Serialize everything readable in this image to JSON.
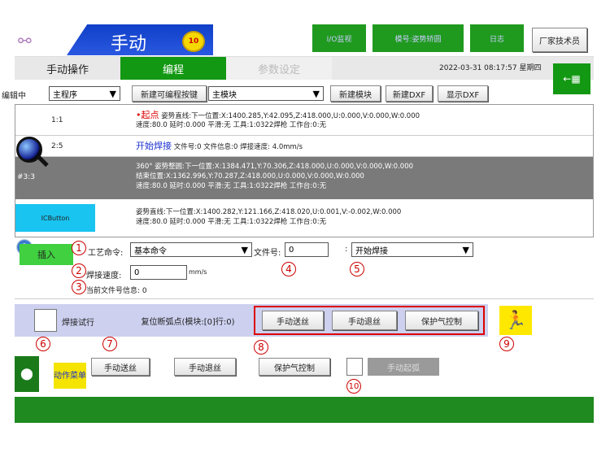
{
  "header": {
    "title": "手动",
    "badge": "10",
    "tabs": [
      "I/O监视",
      "模号:姿势矫圆",
      "日志"
    ],
    "user_button": "厂家技术员"
  },
  "subheader": {
    "tabs": [
      "手动操作",
      "编程",
      "参数设定"
    ],
    "datetime": "2022-03-31  08:17:57  星期四"
  },
  "toolbar": {
    "mode_label": "编辑中",
    "program_select": "主程序",
    "new_button": "新建可编程按键",
    "module_select": "主模块",
    "new_module": "新建模块",
    "new_dxf": "新建DXF",
    "show_dxf": "显示DXF"
  },
  "rows": [
    {
      "num": "1:1",
      "line1_red": "•起点",
      "line1": " 姿势直线:下一位置:X:1400.285,Y:42.095,Z:418.000,U:0.000,V:0.000,W:0.000",
      "line2": "速度:80.0 延时:0.000 平滑:无 工具:1:0322焊枪 工作台:0:无"
    },
    {
      "num": "2:5",
      "line1_red": "开始焊接",
      "line1": " 文件号:0 文件信息:0 焊接速度: 4.0mm/s"
    },
    {
      "num": "#3:3",
      "line0": "360° 姿势整圆:下一位置:X:1384.471,Y:70.306,Z:418.000,U:0.000,V:0.000,W:0.000",
      "line1": "结束位置:X:1362.996,Y:70.287,Z:418.000,U:0.000,V:0.000,W:0.000",
      "line2": "速度:80.0 延时:0.000 平滑:无 工具:1:0322焊枪 工作台:0:无"
    },
    {
      "num": "ICButton",
      "line1": "姿势直线:下一位置:X:1400.282,Y:121.166,Z:418.020,U:0.001,V:-0.002,W:0.000",
      "line2": "速度:80.0 延时:0.000 平滑:无 工具:1:0322焊枪 工作台:0:无"
    }
  ],
  "form": {
    "insert": "插入",
    "process_label": "工艺命令:",
    "process_value": "基本命令",
    "file_label": "文件号:",
    "file_value": "0",
    "cmd_value": "开始焊接",
    "speed_label": "焊接速度:",
    "speed_value": "0",
    "speed_unit": "mm/s",
    "fileinfo_label": "当前文件号信息: 0"
  },
  "trial": {
    "label": "焊接试行",
    "reset": "复位断弧点(模块:[0]行:0)",
    "feed": "手动送丝",
    "retract": "手动退丝",
    "gas": "保护气控制"
  },
  "bottom": {
    "action_menu": "动作菜单",
    "feed": "手动送丝",
    "retract": "手动退丝",
    "gas": "保护气控制",
    "arc": "手动起弧"
  },
  "markers": [
    "1",
    "2",
    "3",
    "4",
    "5",
    "6",
    "7",
    "8",
    "9",
    "10"
  ]
}
